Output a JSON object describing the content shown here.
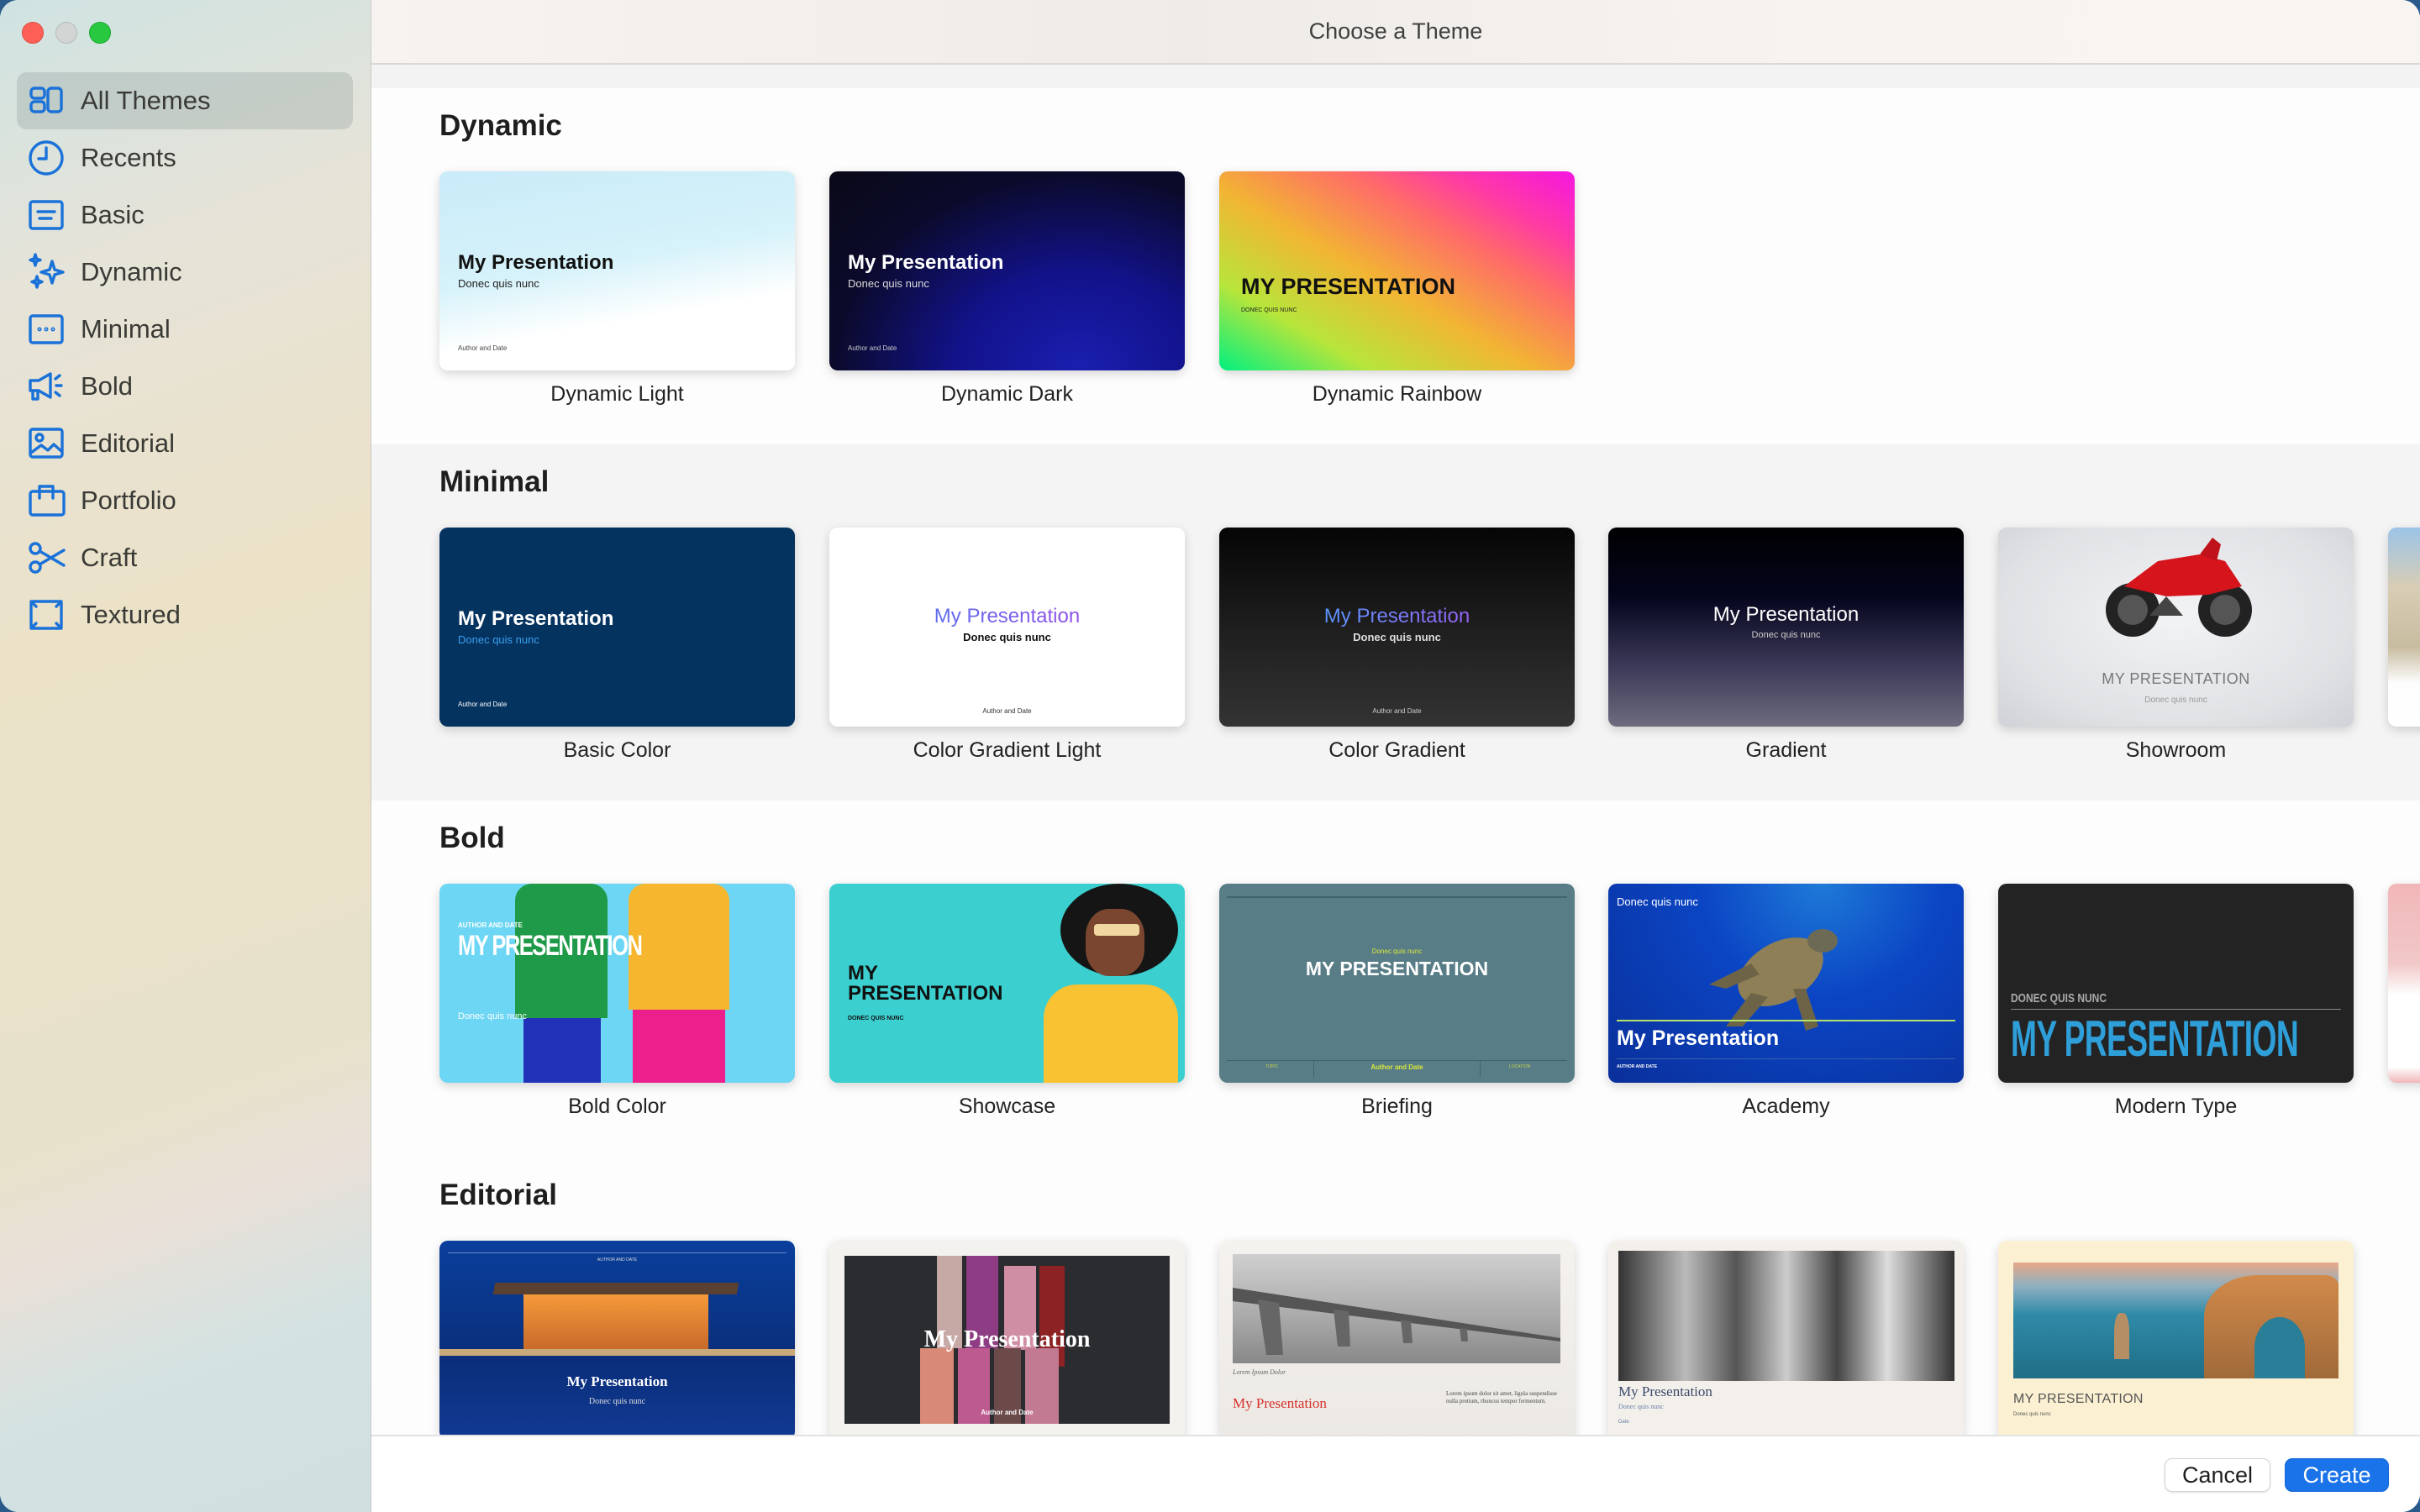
{
  "window": {
    "title": "Choose a Theme",
    "controls": [
      "close",
      "minimize",
      "zoom"
    ]
  },
  "sidebar": {
    "items": [
      {
        "label": "All Themes",
        "icon": "grid-layout-icon",
        "active": true
      },
      {
        "label": "Recents",
        "icon": "clock-icon",
        "active": false
      },
      {
        "label": "Basic",
        "icon": "text-box-icon",
        "active": false
      },
      {
        "label": "Dynamic",
        "icon": "sparkles-icon",
        "active": false
      },
      {
        "label": "Minimal",
        "icon": "ellipsis-box-icon",
        "active": false
      },
      {
        "label": "Bold",
        "icon": "megaphone-icon",
        "active": false
      },
      {
        "label": "Editorial",
        "icon": "photo-icon",
        "active": false
      },
      {
        "label": "Portfolio",
        "icon": "briefcase-icon",
        "active": false
      },
      {
        "label": "Craft",
        "icon": "scissors-icon",
        "active": false
      },
      {
        "label": "Textured",
        "icon": "frame-corners-icon",
        "active": false
      }
    ]
  },
  "sections": [
    {
      "title": "Dynamic",
      "themes": [
        {
          "name": "Dynamic Light",
          "heading": "My Presentation",
          "sub": "Donec quis nunc",
          "author": "Author and Date"
        },
        {
          "name": "Dynamic Dark",
          "heading": "My Presentation",
          "sub": "Donec quis nunc",
          "author": "Author and Date"
        },
        {
          "name": "Dynamic Rainbow",
          "heading": "MY PRESENTATION",
          "sub": "DONEC QUIS NUNC"
        }
      ]
    },
    {
      "title": "Minimal",
      "themes": [
        {
          "name": "Basic Color",
          "heading": "My Presentation",
          "sub": "Donec quis nunc",
          "author": "Author and Date"
        },
        {
          "name": "Color Gradient Light",
          "heading": "My Presentation",
          "sub": "Donec quis nunc",
          "author": "Author and Date"
        },
        {
          "name": "Color Gradient",
          "heading": "My Presentation",
          "sub": "Donec quis nunc",
          "author": "Author and Date"
        },
        {
          "name": "Gradient",
          "heading": "My Presentation",
          "sub": "Donec quis nunc"
        },
        {
          "name": "Showroom",
          "heading": "MY PRESENTATION",
          "sub": "Donec quis nunc"
        }
      ]
    },
    {
      "title": "Bold",
      "themes": [
        {
          "name": "Bold Color",
          "heading": "MY PRESENTATION",
          "sub": "Donec quis nunc",
          "author": "AUTHOR AND DATE"
        },
        {
          "name": "Showcase",
          "heading": "MY PRESENTATION",
          "sub": "DONEC QUIS NUNC"
        },
        {
          "name": "Briefing",
          "heading": "MY PRESENTATION",
          "sub": "Donec quis nunc",
          "author": "Author and Date",
          "left": "TOPIC",
          "right": "LOCATION"
        },
        {
          "name": "Academy",
          "heading": "My Presentation",
          "sub": "Donec quis nunc",
          "author": "AUTHOR AND DATE"
        },
        {
          "name": "Modern Type",
          "heading": "MY PRESENTATION",
          "sub": "DONEC QUIS NUNC"
        }
      ]
    },
    {
      "title": "Editorial",
      "themes": [
        {
          "heading": "My Presentation",
          "sub": "Donec quis nunc",
          "author": "AUTHOR AND DATE"
        },
        {
          "heading": "My Presentation",
          "author": "Author and Date"
        },
        {
          "heading": "My Presentation",
          "caption": "Lorem Ipsum Dolor",
          "body": "Lorem ipsum dolor sit amet, ligula suspendisse nulla pretium, rhoncus tempor fermentum."
        },
        {
          "heading": "My Presentation",
          "sub": "Donec quis nunc",
          "author": "Date"
        },
        {
          "heading": "MY PRESENTATION",
          "sub": "Donec quis nunc"
        }
      ]
    }
  ],
  "footer": {
    "cancel_label": "Cancel",
    "create_label": "Create"
  },
  "colors": {
    "accent": "#1a73e8",
    "sidebar_icon": "#1a72d9"
  }
}
